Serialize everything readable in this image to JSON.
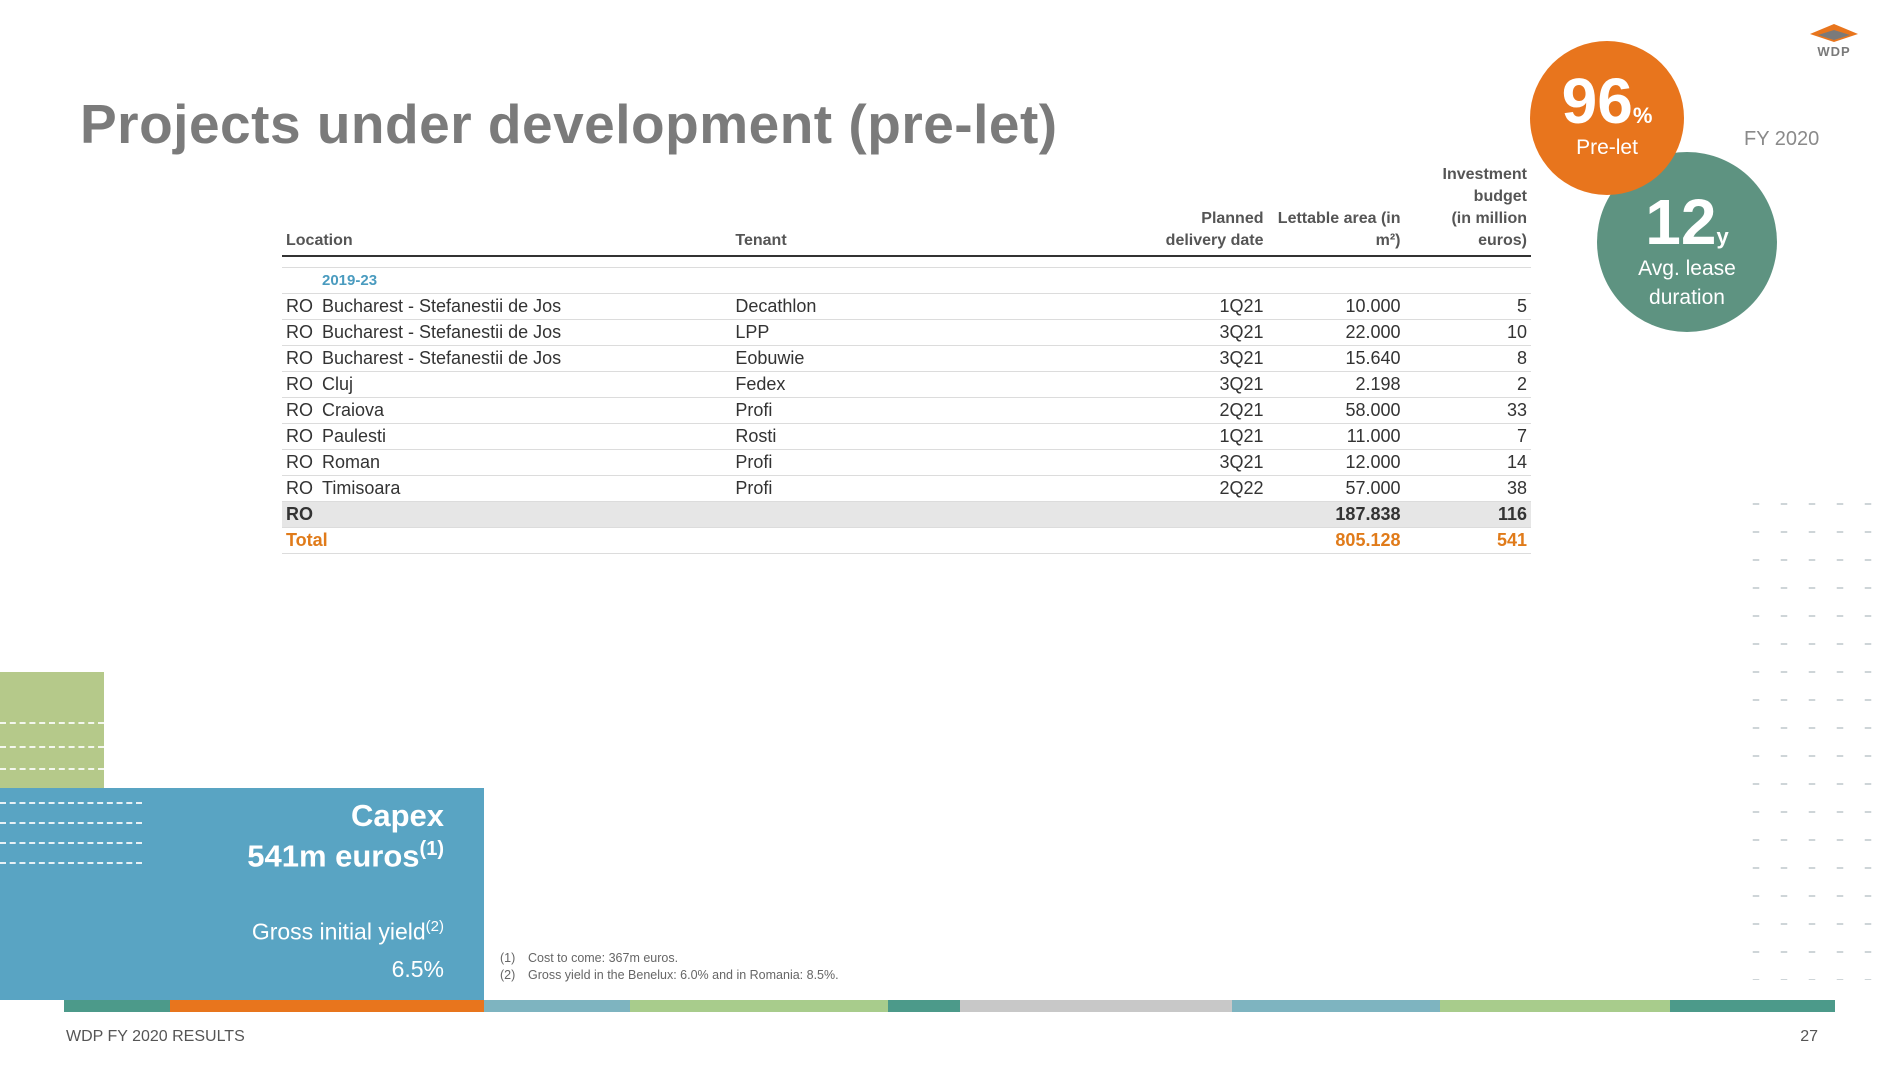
{
  "header": {
    "title": "Projects under development (pre-let)",
    "fy_label": "FY 2020",
    "logo_text": "WDP"
  },
  "kpis": {
    "prelet": {
      "value": "96",
      "unit": "%",
      "label": "Pre-let"
    },
    "lease": {
      "value": "12",
      "unit": "y",
      "label_line1": "Avg. lease",
      "label_line2": "duration"
    }
  },
  "table": {
    "headers": {
      "location": "Location",
      "tenant": "Tenant",
      "delivery": [
        "Planned",
        "delivery date"
      ],
      "area": [
        "Lettable area (in",
        "m²)"
      ],
      "budget": [
        "Investment",
        "budget",
        "(in million",
        "euros)"
      ]
    },
    "period": "2019-23",
    "rows": [
      {
        "country": "RO",
        "location": "Bucharest - Stefanestii de Jos",
        "tenant": "Decathlon",
        "delivery": "1Q21",
        "area": "10.000",
        "budget": "5"
      },
      {
        "country": "RO",
        "location": "Bucharest - Stefanestii de Jos",
        "tenant": "LPP",
        "delivery": "3Q21",
        "area": "22.000",
        "budget": "10"
      },
      {
        "country": "RO",
        "location": "Bucharest - Stefanestii de Jos",
        "tenant": "Eobuwie",
        "delivery": "3Q21",
        "area": "15.640",
        "budget": "8"
      },
      {
        "country": "RO",
        "location": "Cluj",
        "tenant": "Fedex",
        "delivery": "3Q21",
        "area": "2.198",
        "budget": "2"
      },
      {
        "country": "RO",
        "location": "Craiova",
        "tenant": "Profi",
        "delivery": "2Q21",
        "area": "58.000",
        "budget": "33"
      },
      {
        "country": "RO",
        "location": "Paulesti",
        "tenant": "Rosti",
        "delivery": "1Q21",
        "area": "11.000",
        "budget": "7"
      },
      {
        "country": "RO",
        "location": "Roman",
        "tenant": "Profi",
        "delivery": "3Q21",
        "area": "12.000",
        "budget": "14"
      },
      {
        "country": "RO",
        "location": "Timisoara",
        "tenant": "Profi",
        "delivery": "2Q22",
        "area": "57.000",
        "budget": "38"
      }
    ],
    "subtotal": {
      "label": "RO",
      "area": "187.838",
      "budget": "116"
    },
    "total": {
      "label": "Total",
      "area": "805.128",
      "budget": "541"
    }
  },
  "capex": {
    "title": "Capex",
    "amount": "541m euros",
    "amount_note": "(1)",
    "yield_label": "Gross initial yield",
    "yield_note": "(2)",
    "yield_value": "6.5%"
  },
  "footnotes": [
    {
      "num": "(1)",
      "text": "Cost to come: 367m euros."
    },
    {
      "num": "(2)",
      "text": "Gross yield in the Benelux: 6.0% and in Romania: 8.5%."
    }
  ],
  "footer": {
    "left": "WDP FY 2020 RESULTS",
    "page": "27"
  },
  "colors": {
    "orange": "#e8751d",
    "green": "#5e9381",
    "blue": "#59a4c3",
    "light_green": "#b5c98a"
  }
}
